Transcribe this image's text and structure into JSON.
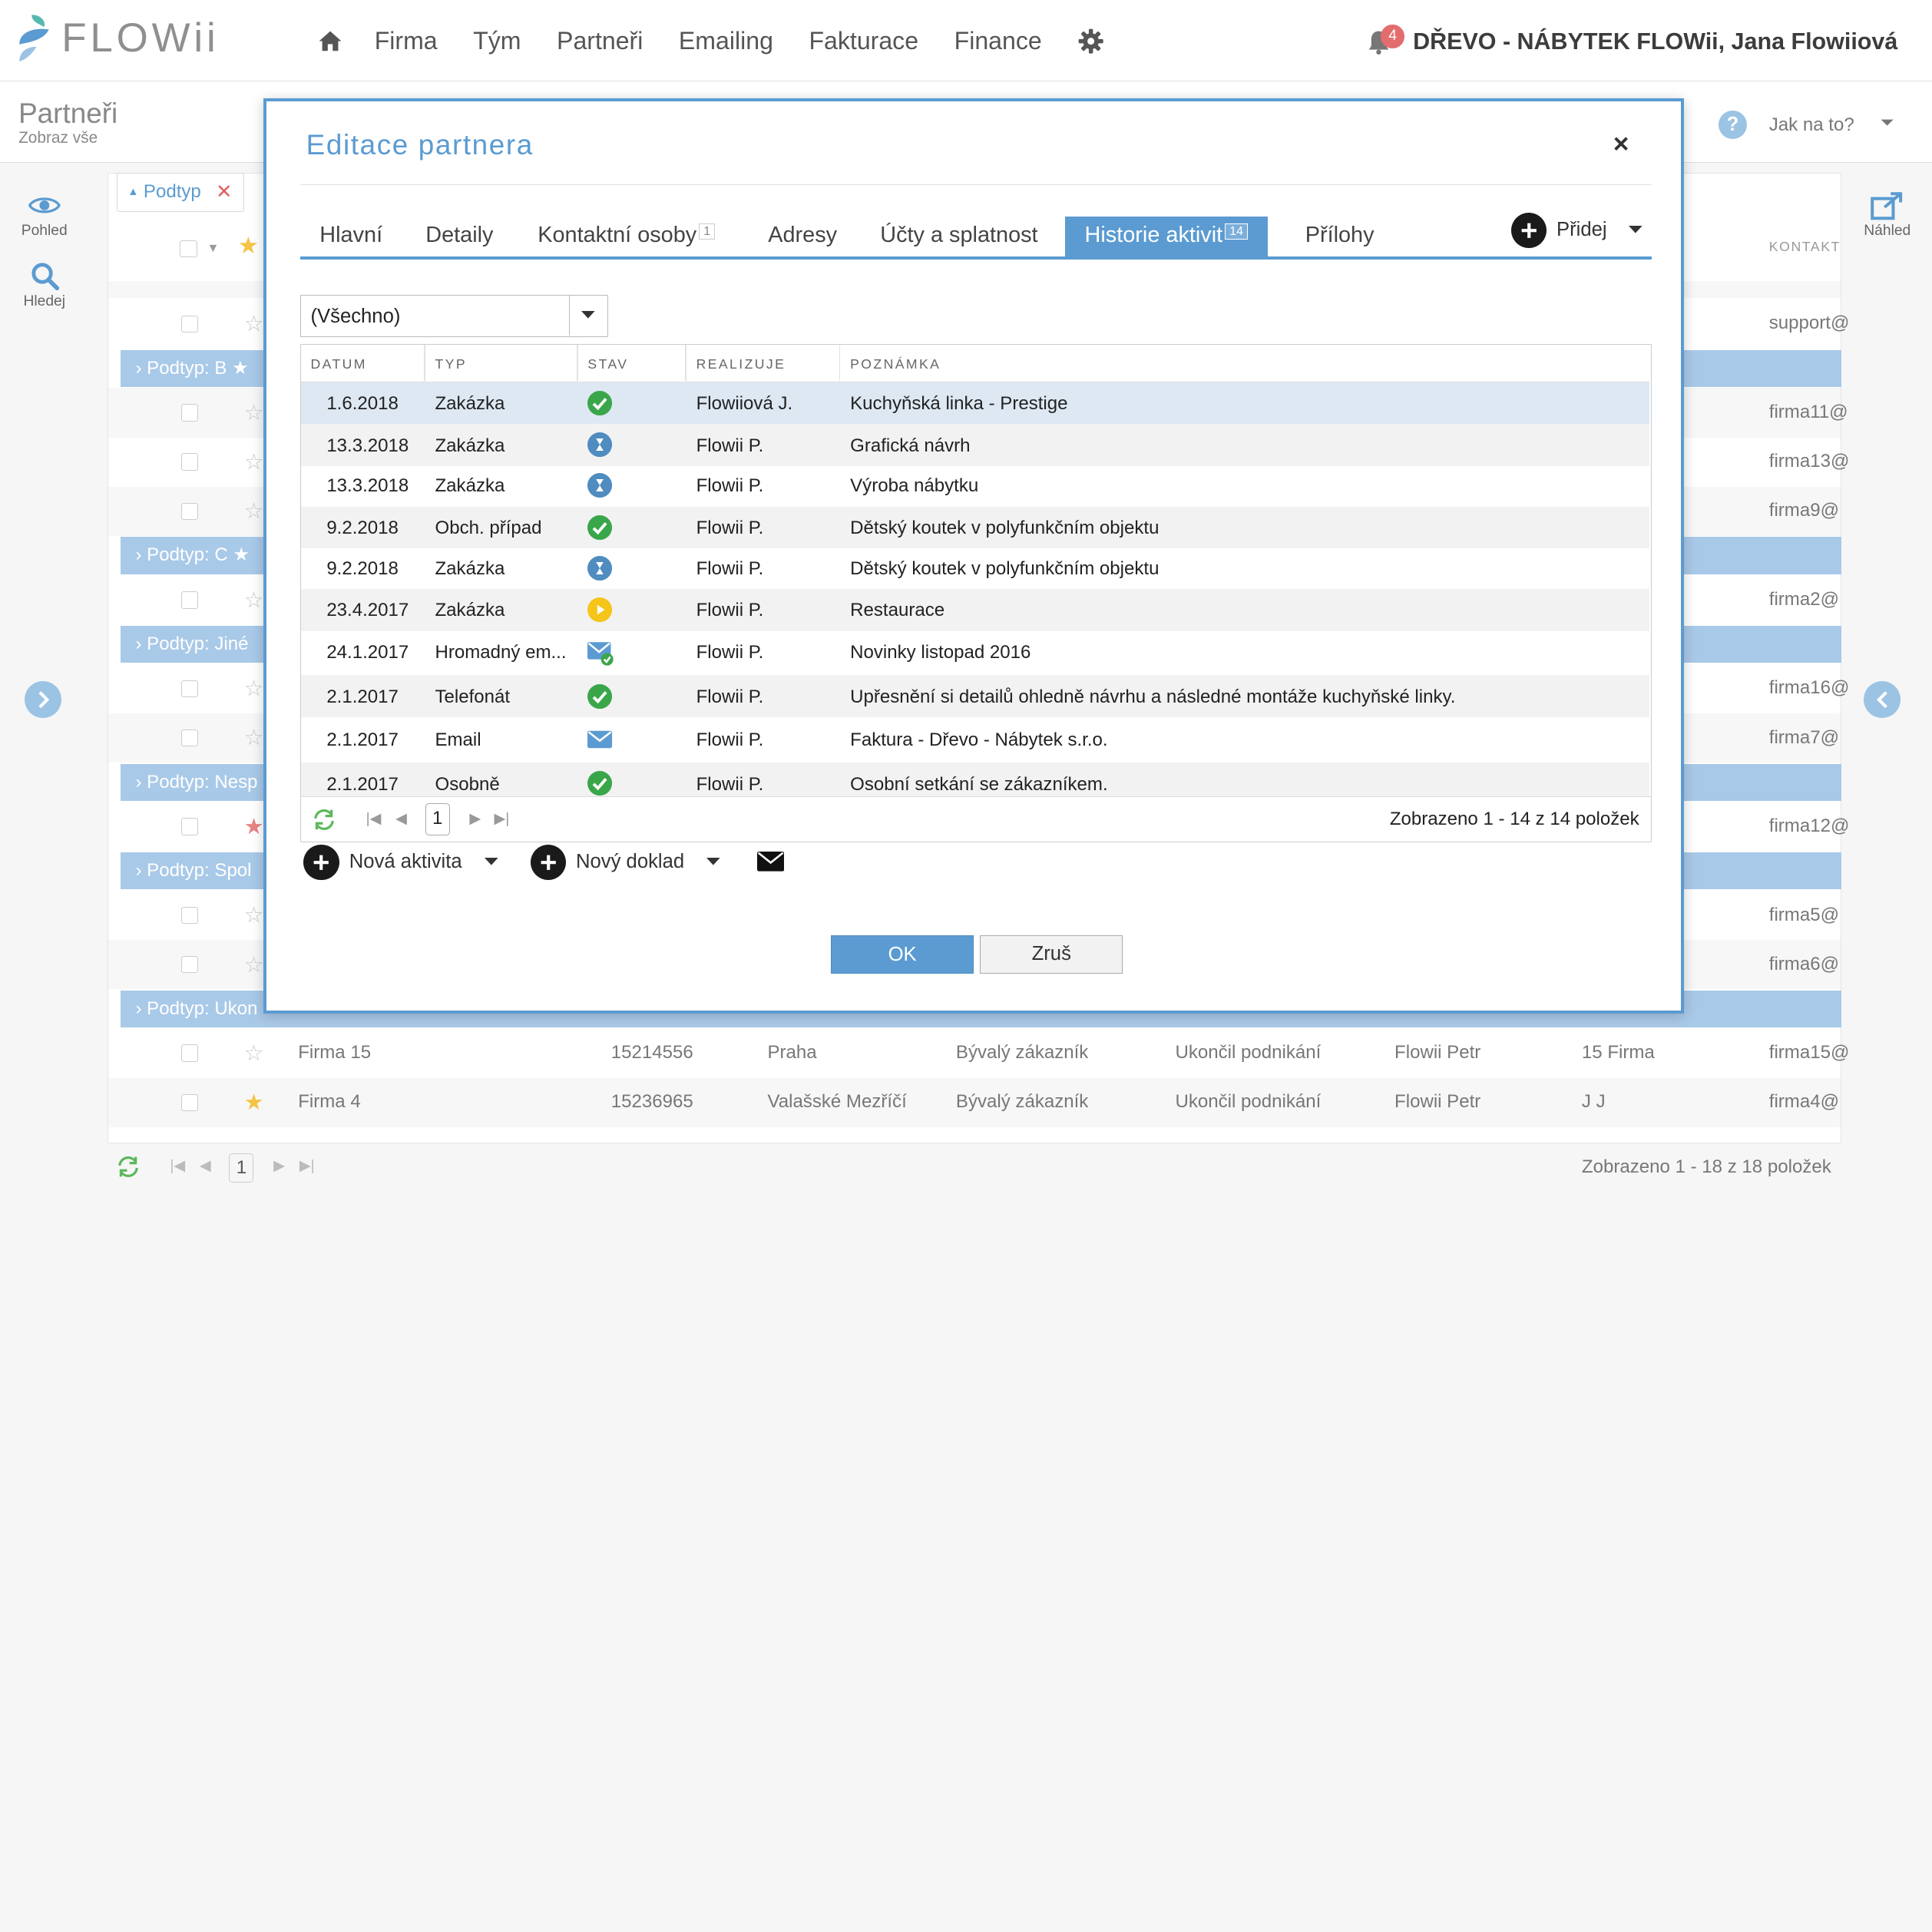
{
  "app": {
    "logo_text": "FLOWii",
    "company_user": "DŘEVO - NÁBYTEK FLOWii, Jana Flowiiová",
    "notification_count": "4"
  },
  "nav": {
    "items": [
      "Firma",
      "Tým",
      "Partneři",
      "Emailing",
      "Fakturace",
      "Finance"
    ]
  },
  "page": {
    "title": "Partneři",
    "subtitle": "Zobraz vše",
    "help_label": "Jak na to?"
  },
  "left_sidebar": {
    "view_label": "Pohled",
    "search_label": "Hledej"
  },
  "right_sidebar": {
    "preview_label": "Náhled"
  },
  "background_grid": {
    "filter_chip": "Podtyp",
    "contact_header": "KONTAKT",
    "groups": [
      "Podtyp: B",
      "Podtyp: C",
      "Podtyp: Jiné",
      "Podtyp: Nesp",
      "Podtyp: Spol",
      "Podtyp: Ukon"
    ],
    "emails": [
      "support@",
      "firma11@",
      "firma13@",
      "firma9@",
      "firma2@",
      "firma16@",
      "firma7@",
      "firma12@",
      "firma5@",
      "firma6@"
    ],
    "rows": [
      {
        "name": "Firma 15",
        "ic": "15214556",
        "city": "Praha",
        "type": "Bývalý zákazník",
        "state": "Ukončil podnikání",
        "owner": "Flowii Petr",
        "contact": "15 Firma",
        "email": "firma15@"
      },
      {
        "name": "Firma 4",
        "ic": "15236965",
        "city": "Valašské Mezříčí",
        "type": "Bývalý zákazník",
        "state": "Ukončil podnikání",
        "owner": "Flowii Petr",
        "contact": "J J",
        "email": "firma4@"
      }
    ],
    "pager_page": "1",
    "pager_info": "Zobrazeno 1 - 18 z 18 položek"
  },
  "modal": {
    "title": "Editace partnera",
    "close_label": "×",
    "tabs": [
      {
        "label": "Hlavní"
      },
      {
        "label": "Detaily"
      },
      {
        "label": "Kontaktní osoby",
        "count": "1"
      },
      {
        "label": "Adresy"
      },
      {
        "label": "Účty a splatnost"
      },
      {
        "label": "Historie aktivit",
        "count": "14",
        "active": true
      },
      {
        "label": "Přílohy"
      }
    ],
    "add_label": "Přidej",
    "filter_value": "(Všechno)",
    "columns": [
      "DATUM",
      "TYP",
      "STAV",
      "REALIZUJE",
      "POZNÁMKA"
    ],
    "rows": [
      {
        "date": "1.6.2018",
        "type": "Zakázka",
        "status": "done",
        "by": "Flowiiová J.",
        "note": "Kuchyňská linka - Prestige"
      },
      {
        "date": "13.3.2018",
        "type": "Zakázka",
        "status": "waiting",
        "by": "Flowii P.",
        "note": "Grafická návrh"
      },
      {
        "date": "13.3.2018",
        "type": "Zakázka",
        "status": "waiting",
        "by": "Flowii P.",
        "note": "Výroba nábytku"
      },
      {
        "date": "9.2.2018",
        "type": "Obch. případ",
        "status": "done",
        "by": "Flowii P.",
        "note": "Dětský koutek v polyfunkčním objektu"
      },
      {
        "date": "9.2.2018",
        "type": "Zakázka",
        "status": "waiting",
        "by": "Flowii P.",
        "note": "Dětský koutek v polyfunkčním objektu"
      },
      {
        "date": "23.4.2017",
        "type": "Zakázka",
        "status": "in-progress",
        "by": "Flowii P.",
        "note": "Restaurace"
      },
      {
        "date": "24.1.2017",
        "type": "Hromadný em...",
        "status": "email-sent",
        "by": "Flowii P.",
        "note": "Novinky listopad 2016"
      },
      {
        "date": "2.1.2017",
        "type": "Telefonát",
        "status": "done",
        "by": "Flowii P.",
        "note": "Upřesnění si detailů ohledně návrhu a následné montáže kuchyňské linky."
      },
      {
        "date": "2.1.2017",
        "type": "Email",
        "status": "email",
        "by": "Flowii P.",
        "note": "Faktura - Dřevo - Nábytek s.r.o."
      },
      {
        "date": "2.1.2017",
        "type": "Osobně",
        "status": "done",
        "by": "Flowii P.",
        "note": "Osobní setkání se zákazníkem."
      }
    ],
    "pager_page": "1",
    "pager_info": "Zobrazeno 1 - 14 z 14 položek",
    "new_activity_label": "Nová aktivita",
    "new_document_label": "Nový doklad",
    "ok_label": "OK",
    "cancel_label": "Zruš"
  },
  "colors": {
    "accent": "#5b9bd1",
    "group_row": "#a9c9e8",
    "status_done": "#3aa64a",
    "status_waiting": "#4f8cc0",
    "status_progress": "#f5c518",
    "badge": "#e36d6d"
  }
}
